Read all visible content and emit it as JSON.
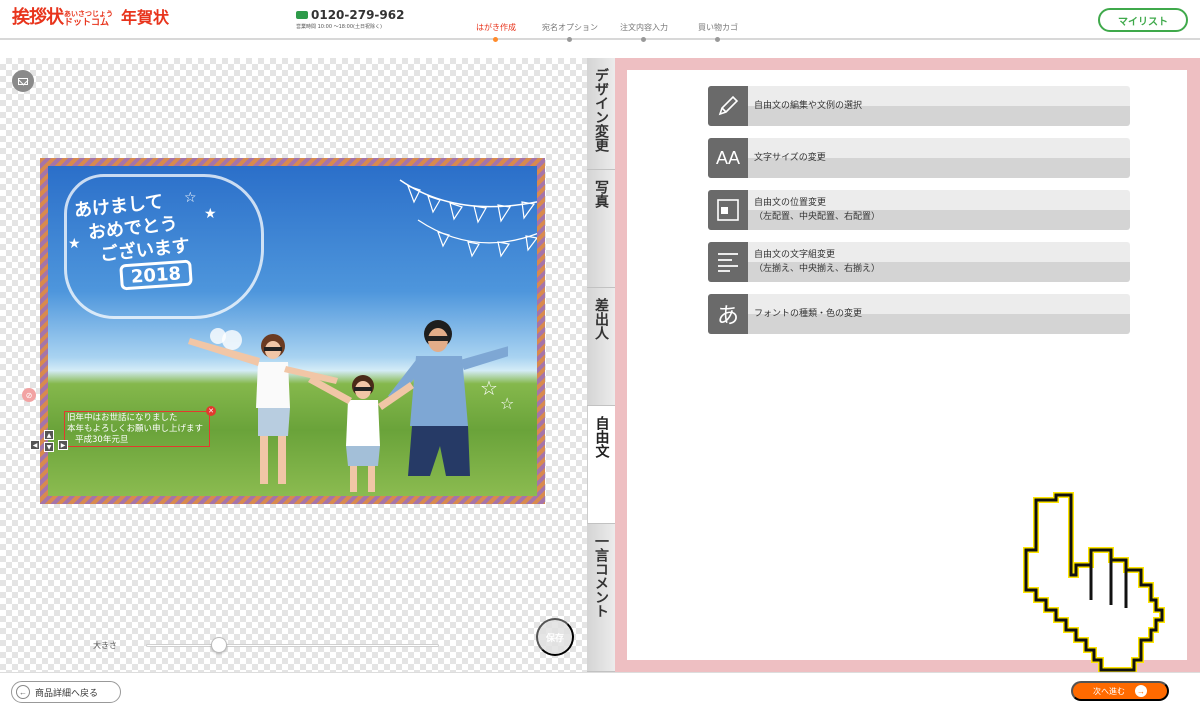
{
  "header": {
    "logo_main": "挨拶状",
    "logo_ruby": "あいさつじょう",
    "logo_dot": "ドットコム",
    "logo_nenga": "年賀状",
    "phone_number": "0120-279-962",
    "phone_hours": "営業時間 10:00 ～18:00(土日祝除く)",
    "steps": [
      {
        "label": "はがき作成",
        "active": true
      },
      {
        "label": "宛名オプション",
        "active": false
      },
      {
        "label": "注文内容入力",
        "active": false
      },
      {
        "label": "買い物カゴ",
        "active": false
      }
    ],
    "mylist_label": "マイリスト"
  },
  "card": {
    "greeting_lines": [
      "あけまして",
      "おめでとう",
      "ございます"
    ],
    "greeting_year": "2018",
    "message_lines": [
      "旧年中はお世話になりました",
      "本年もよろしくお願い申し上げます",
      "平成30年元旦"
    ]
  },
  "editor": {
    "size_label": "大きさ",
    "slider_value": 0.25,
    "save_label": "保存"
  },
  "tabs": [
    {
      "label": "デザイン変更",
      "active": false
    },
    {
      "label": "写真",
      "active": false
    },
    {
      "label": "差出人",
      "active": false
    },
    {
      "label": "自由文",
      "active": true
    },
    {
      "label": "一言コメント",
      "active": false
    }
  ],
  "menu": [
    {
      "icon": "pencil-icon",
      "line1": "自由文の編集や文例の選択",
      "line2": ""
    },
    {
      "icon": "font-size-icon",
      "line1": "文字サイズの変更",
      "line2": ""
    },
    {
      "icon": "position-icon",
      "line1": "自由文の位置変更",
      "line2": "（左配置、中央配置、右配置）"
    },
    {
      "icon": "align-icon",
      "line1": "自由文の文字組変更",
      "line2": "（左揃え、中央揃え、右揃え）"
    },
    {
      "icon": "font-type-icon",
      "line1": "フォントの種類・色の変更",
      "line2": ""
    }
  ],
  "menu_icon_glyphs": {
    "font_size": "AA",
    "font_type": "あ"
  },
  "footer": {
    "back_label": "商品詳細へ戻る",
    "next_label": "次へ進む"
  },
  "colors": {
    "brand_red": "#e8341c",
    "green": "#3fa94b",
    "orange": "#ff6a00",
    "panel_pink": "#eebfc2"
  }
}
